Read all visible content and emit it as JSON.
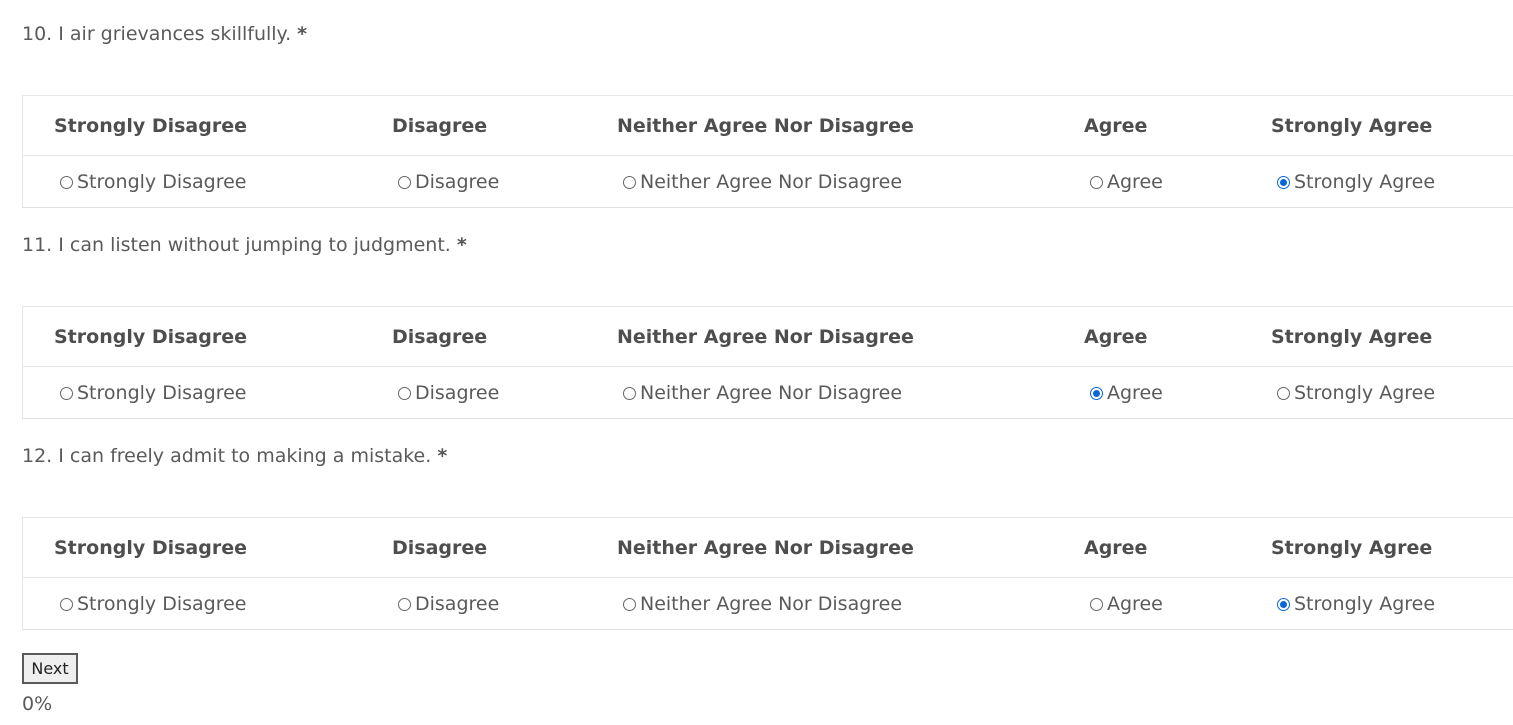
{
  "questions": [
    {
      "text": "10. I air grievances skillfully.",
      "required_mark": "*",
      "headers": [
        "Strongly Disagree",
        "Disagree",
        "Neither Agree Nor Disagree",
        "Agree",
        "Strongly Agree"
      ],
      "options": [
        "Strongly Disagree",
        "Disagree",
        "Neither Agree Nor Disagree",
        "Agree",
        "Strongly Agree"
      ],
      "selected": "Strongly Agree"
    },
    {
      "text": "11. I can listen without jumping to judgment.",
      "required_mark": "*",
      "headers": [
        "Strongly Disagree",
        "Disagree",
        "Neither Agree Nor Disagree",
        "Agree",
        "Strongly Agree"
      ],
      "options": [
        "Strongly Disagree",
        "Disagree",
        "Neither Agree Nor Disagree",
        "Agree",
        "Strongly Agree"
      ],
      "selected": "Agree"
    },
    {
      "text": "12. I can freely admit to making a mistake.",
      "required_mark": "*",
      "headers": [
        "Strongly Disagree",
        "Disagree",
        "Neither Agree Nor Disagree",
        "Agree",
        "Strongly Agree"
      ],
      "options": [
        "Strongly Disagree",
        "Disagree",
        "Neither Agree Nor Disagree",
        "Agree",
        "Strongly Agree"
      ],
      "selected": "Strongly Agree"
    }
  ],
  "next_button": {
    "label": "Next"
  },
  "progress": {
    "text": "0%",
    "value": 0
  },
  "colors": {
    "accent": "#0a66d8",
    "text": "#555555",
    "border": "#e6e6e6"
  }
}
